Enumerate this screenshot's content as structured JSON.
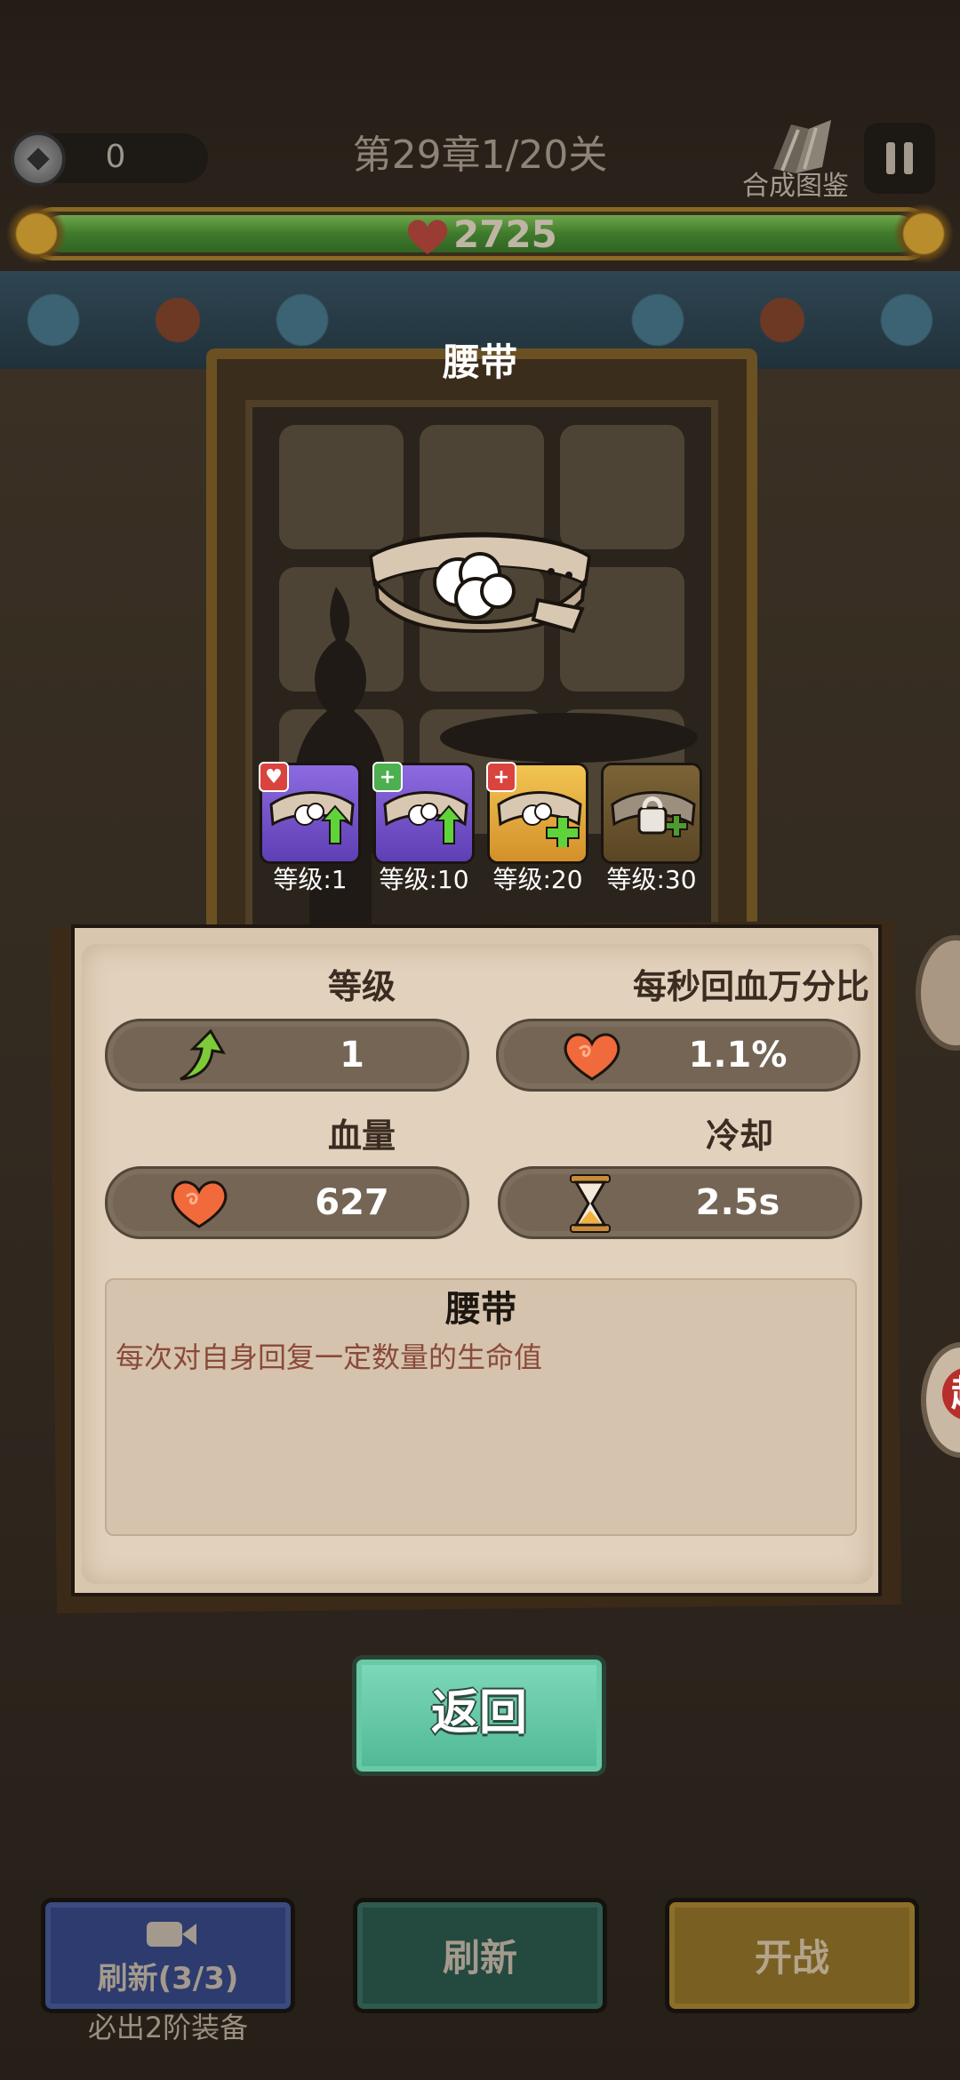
{
  "hud": {
    "coins": "0",
    "chapter": "第29章1/20关",
    "codex_label": "合成图鉴",
    "hp": "2725"
  },
  "equipment": {
    "title": "腰带",
    "levels": [
      {
        "label": "等级:1",
        "tier": "purple",
        "badge": "heart"
      },
      {
        "label": "等级:10",
        "tier": "purple",
        "badge": "plus"
      },
      {
        "label": "等级:20",
        "tier": "gold",
        "badge": "plus-red"
      },
      {
        "label": "等级:30",
        "tier": "brown-locked",
        "badge": ""
      }
    ]
  },
  "stats": {
    "level_label": "等级",
    "level_value": "1",
    "regen_label": "每秒回血万分比",
    "regen_value": "1.1%",
    "hp_label": "血量",
    "hp_value": "627",
    "cooldown_label": "冷却",
    "cooldown_value": "2.5s"
  },
  "description": {
    "title": "腰带",
    "text": "每次对自身回复一定数量的生命值"
  },
  "buttons": {
    "back": "返回",
    "refresh_ad": "刷新(3/3)",
    "refresh_ad_caption": "必出2阶装备",
    "refresh": "刷新",
    "battle": "开战"
  },
  "side": {
    "item2_glyph": "起"
  },
  "colors": {
    "hp_green": "#3f7a2c",
    "back_button": "#5fc4a0",
    "parchment": "#e2d1bc",
    "card_purple": "#7651cc",
    "card_gold": "#e6ad3f",
    "text_desc": "#8a4a3a"
  }
}
